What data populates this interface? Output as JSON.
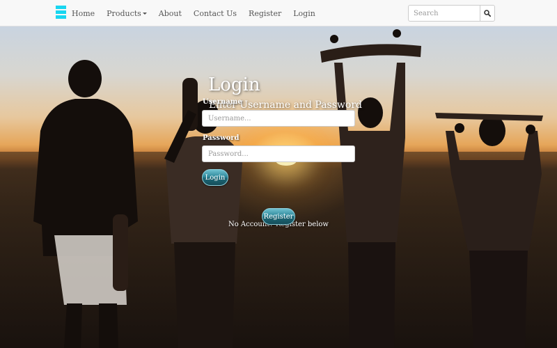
{
  "navbar": {
    "logo_icon": "menu-bars-icon",
    "links": [
      {
        "label": "Home"
      },
      {
        "label": "Products",
        "has_caret": true
      },
      {
        "label": "About"
      },
      {
        "label": "Contact Us"
      },
      {
        "label": "Register"
      },
      {
        "label": "Login"
      }
    ],
    "search": {
      "placeholder": "Search",
      "icon": "search-icon"
    }
  },
  "login": {
    "title": "Login",
    "subtitle": "Enter Username and Password",
    "username_label": "Username",
    "username_placeholder": "Username...",
    "password_label": "Password",
    "password_placeholder": "Password...",
    "login_button": "Login",
    "no_account_text": "No Account? Register below",
    "register_button": "Register"
  },
  "colors": {
    "accent": "#19d6f0",
    "button": "#2f8a9c"
  }
}
